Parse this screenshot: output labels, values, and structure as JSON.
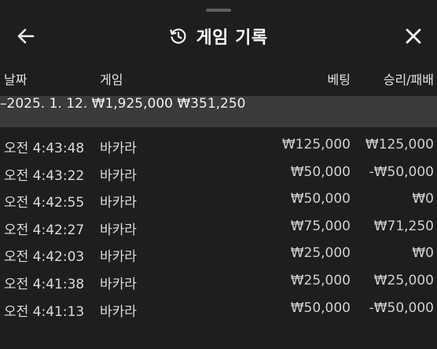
{
  "header": {
    "title": "게임 기록"
  },
  "columns": {
    "date": "날짜",
    "game": "게임",
    "bet": "베팅",
    "win_loss": "승리/패배"
  },
  "summary": {
    "date": "–2025. 1. 12.",
    "bet": "₩1,925,000",
    "win_loss": "₩351,250"
  },
  "rows": [
    {
      "time": "오전 4:43:48",
      "game": "바카라",
      "bet": "₩125,000",
      "win_loss": "₩125,000"
    },
    {
      "time": "오전 4:43:22",
      "game": "바카라",
      "bet": "₩50,000",
      "win_loss": "-₩50,000"
    },
    {
      "time": "오전 4:42:55",
      "game": "바카라",
      "bet": "₩50,000",
      "win_loss": "₩0"
    },
    {
      "time": "오전 4:42:27",
      "game": "바카라",
      "bet": "₩75,000",
      "win_loss": "₩71,250"
    },
    {
      "time": "오전 4:42:03",
      "game": "바카라",
      "bet": "₩25,000",
      "win_loss": "₩0"
    },
    {
      "time": "오전 4:41:38",
      "game": "바카라",
      "bet": "₩25,000",
      "win_loss": "₩25,000"
    },
    {
      "time": "오전 4:41:13",
      "game": "바카라",
      "bet": "₩50,000",
      "win_loss": "-₩50,000"
    }
  ],
  "icons": {
    "back": "arrow-left-icon",
    "history": "history-icon",
    "close": "close-icon"
  },
  "colors": {
    "background": "#1e1e1e",
    "summary_row": "#3a3a3a",
    "text": "#ededed"
  }
}
